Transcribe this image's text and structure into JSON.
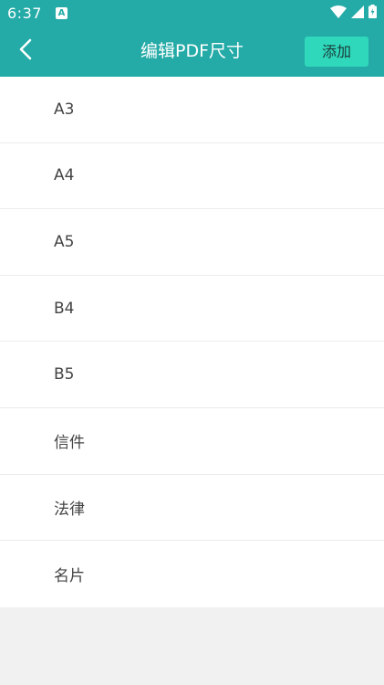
{
  "status_bar": {
    "time": "6:37",
    "notification_icon": "A",
    "icons": [
      "wifi-icon",
      "signal-icon",
      "battery-icon"
    ]
  },
  "toolbar": {
    "title": "编辑PDF尺寸",
    "add_label": "添加",
    "back_icon": "chevron-left-icon"
  },
  "sizes": [
    "A3",
    "A4",
    "A5",
    "B4",
    "B5",
    "信件",
    "法律",
    "名片"
  ],
  "colors": {
    "primary": "#24aba7",
    "accent_button": "#2fd7bb",
    "background": "#f1f1f1",
    "item_text": "#444444"
  }
}
